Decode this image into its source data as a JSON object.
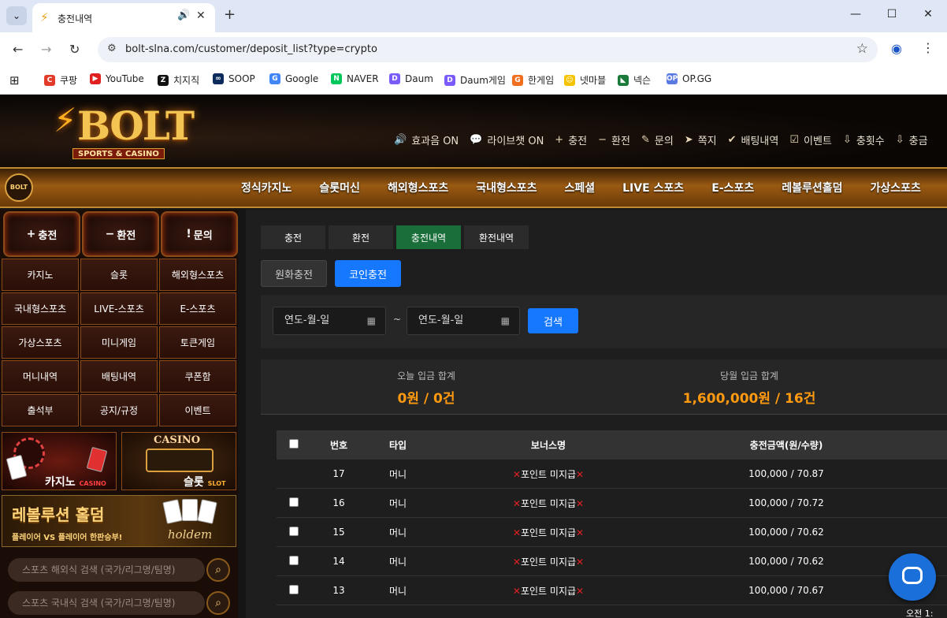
{
  "browser": {
    "tab_title": "충전내역",
    "url": "bolt-slna.com/customer/deposit_list?type=crypto",
    "bookmarks": [
      {
        "label": "쿠팡",
        "color": "#e23b2a",
        "glyph": "C"
      },
      {
        "label": "YouTube",
        "color": "#e02020",
        "glyph": "▶"
      },
      {
        "label": "치지직",
        "color": "#111111",
        "glyph": "Z"
      },
      {
        "label": "SOOP",
        "color": "#0d2a5c",
        "glyph": "∞"
      },
      {
        "label": "Google",
        "color": "#4285f4",
        "glyph": "G"
      },
      {
        "label": "NAVER",
        "color": "#03c75a",
        "glyph": "N"
      },
      {
        "label": "Daum",
        "color": "#7a5af8",
        "glyph": "D"
      },
      {
        "label": "Daum게임",
        "color": "#7a5af8",
        "glyph": "D"
      },
      {
        "label": "한게임",
        "color": "#f07020",
        "glyph": "G"
      },
      {
        "label": "넷마블",
        "color": "#f5c400",
        "glyph": "☺"
      },
      {
        "label": "넥슨",
        "color": "#1a7a3a",
        "glyph": "◣"
      },
      {
        "label": "OP.GG",
        "color": "#5a7adf",
        "glyph": "OP"
      }
    ]
  },
  "header": {
    "logo": "BOLT",
    "logo_sub": "SPORTS & CASINO",
    "utils": [
      {
        "icon": "🔊",
        "label": "효과음 ON"
      },
      {
        "icon": "💬",
        "label": "라이브챗 ON"
      },
      {
        "icon": "+",
        "label": "충전"
      },
      {
        "icon": "−",
        "label": "환전"
      },
      {
        "icon": "✎",
        "label": "문의"
      },
      {
        "icon": "➤",
        "label": "쪽지"
      },
      {
        "icon": "✔",
        "label": "배팅내역"
      },
      {
        "icon": "☑",
        "label": "이벤트"
      },
      {
        "icon": "⇩",
        "label": "충횟수"
      },
      {
        "icon": "⇩",
        "label": "충금"
      }
    ]
  },
  "mainnav": {
    "logo": "BOLT",
    "items": [
      "정식카지노",
      "슬롯머신",
      "해외형스포츠",
      "국내형스포츠",
      "스페셜",
      "LIVE 스포츠",
      "E-스포츠",
      "레볼루션홀덤",
      "가상스포츠"
    ]
  },
  "sidebar": {
    "topbuttons": [
      {
        "glyph": "+",
        "label": "충전"
      },
      {
        "glyph": "−",
        "label": "환전"
      },
      {
        "glyph": "!",
        "label": "문의"
      }
    ],
    "menu": [
      "카지노",
      "슬롯",
      "해외형스포츠",
      "국내형스포츠",
      "LIVE-스포츠",
      "E-스포츠",
      "가상스포츠",
      "미니게임",
      "토큰게임",
      "머니내역",
      "배팅내역",
      "쿠폰함",
      "출석부",
      "공지/규정",
      "이벤트"
    ],
    "banner_casino": {
      "title": "카지노",
      "sub": "CASINO"
    },
    "banner_slot": {
      "top": "CASINO",
      "title": "슬롯",
      "sub": "SLOT"
    },
    "banner_holdem": {
      "title": "레볼루션 홀덤",
      "sub": "플레이어 VS 플레이어 한판승부!",
      "brand": "holdem"
    },
    "search1_placeholder": "스포츠 해외식 검색 (국가/리그명/팀명)",
    "search2_placeholder": "스포츠 국내식 검색 (국가/리그명/팀명)"
  },
  "content": {
    "tabs": [
      "충전",
      "환전",
      "충전내역",
      "환전내역"
    ],
    "active_tab": 2,
    "subtabs": [
      "원화충전",
      "코인충전"
    ],
    "active_subtab": 1,
    "date_from": "연도-월-일",
    "date_to": "연도-월-일",
    "tilde": "~",
    "search_label": "검색",
    "summary_today_label": "오늘 입금 합계",
    "summary_today_value": "0원 / 0건",
    "summary_month_label": "당월 입금 합계",
    "summary_month_value": "1,600,000원 / 16건",
    "table": {
      "headers": [
        "번호",
        "타입",
        "보너스명",
        "충전금액(원/수량)"
      ],
      "rows": [
        {
          "no": "17",
          "type": "머니",
          "bonus": "포인트 미지급",
          "amount": "100,000 / 70.87",
          "checkbox": false
        },
        {
          "no": "16",
          "type": "머니",
          "bonus": "포인트 미지급",
          "amount": "100,000 / 70.72",
          "checkbox": true
        },
        {
          "no": "15",
          "type": "머니",
          "bonus": "포인트 미지급",
          "amount": "100,000 / 70.62",
          "checkbox": true
        },
        {
          "no": "14",
          "type": "머니",
          "bonus": "포인트 미지급",
          "amount": "100,000 / 70.62",
          "checkbox": true
        },
        {
          "no": "13",
          "type": "머니",
          "bonus": "포인트 미지급",
          "amount": "100,000 / 70.67",
          "checkbox": true
        }
      ]
    }
  },
  "taskbar": {
    "time": "오전 1:"
  }
}
